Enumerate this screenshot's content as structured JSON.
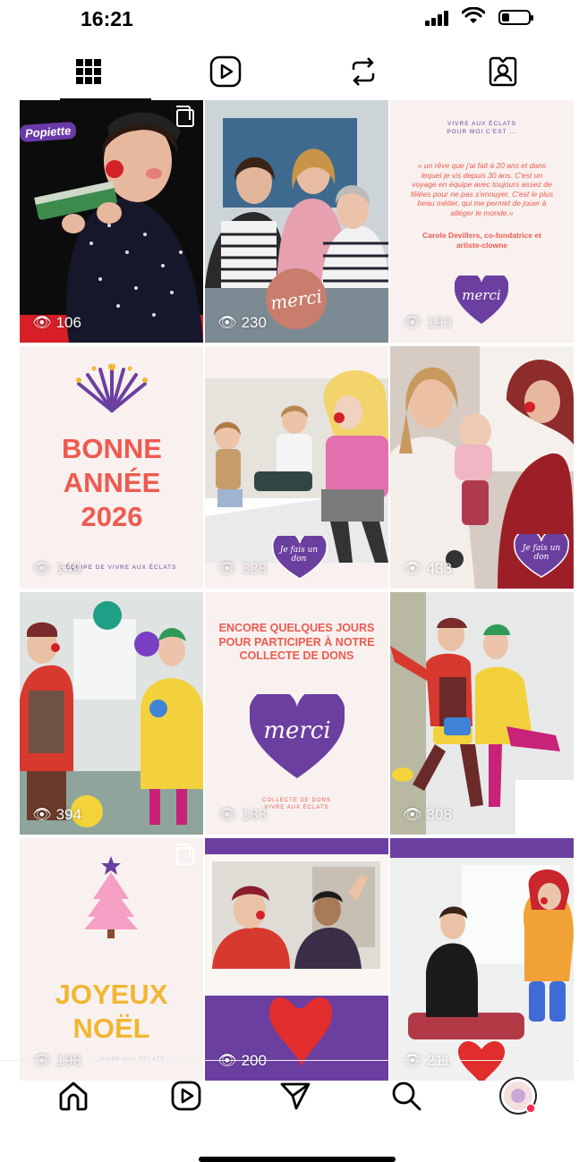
{
  "status_bar": {
    "time": "16:21"
  },
  "tabs": [
    {
      "label": "grid-icon",
      "active": true
    },
    {
      "label": "reels-icon",
      "active": false
    },
    {
      "label": "repost-icon",
      "active": false
    },
    {
      "label": "tagged-icon",
      "active": false
    }
  ],
  "posts": [
    {
      "views": "106",
      "sticker": "Popiette"
    },
    {
      "views": "230",
      "badge": "merci"
    },
    {
      "views": "193",
      "heading": "VIVRE AUX ÉCLATS\nPOUR MOI C'EST ...",
      "quote": "« un rêve que j'ai fait à 20 ans et dans lequel je vis depuis 30 ans. C'est un voyage en équipe avec toujours assez de fêlées pour ne pas s'ennuyer. C'est le plus beau métier, qui me permet de jouer à alléger le monde.»",
      "author": "Carole Devillers, co-fondatrice et artiste-clowne",
      "badge": "merci"
    },
    {
      "views": "149",
      "title": "BONNE ANNÉE 2026",
      "footer": "L'ÉQUIPE DE VIVRE AUX ÉCLATS"
    },
    {
      "views": "328",
      "badge": "Je fais un don"
    },
    {
      "views": "433",
      "badge": "Je fais un don"
    },
    {
      "views": "394"
    },
    {
      "views": "183",
      "title": "ENCORE QUELQUES JOURS POUR PARTICIPER À NOTRE COLLECTE DE DONS",
      "badge": "merci",
      "footer": "COLLECTE DE DONS\nVIVRE AUX ÉCLATS"
    },
    {
      "views": "308"
    },
    {
      "views": "198",
      "title": "JOYEUX NOËL",
      "footer": "VIVRE AUX ÉCLATS"
    },
    {
      "views": "200"
    },
    {
      "views": "211"
    }
  ],
  "bottom_nav": [
    "home-icon",
    "reels-icon",
    "messages-icon",
    "search-icon",
    "profile-avatar"
  ],
  "colors": {
    "coral": "#ee5a4f",
    "purple": "#6b3fa0",
    "yellow": "#f2b632",
    "blush": "#f8f1ef"
  }
}
